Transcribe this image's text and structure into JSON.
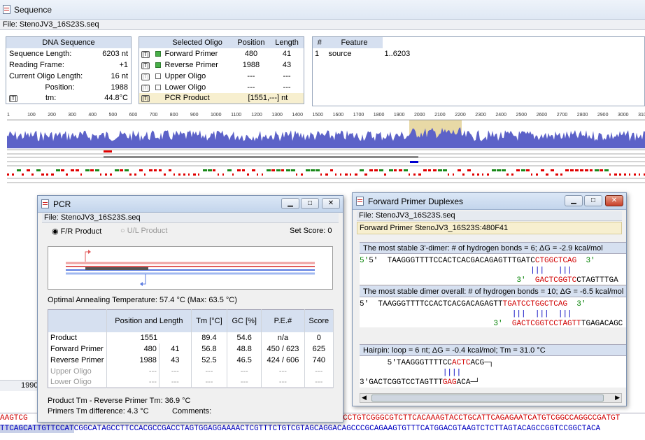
{
  "window": {
    "title": "Sequence",
    "file": "File: StenoJV3_16S23S.seq"
  },
  "dna": {
    "header": "DNA Sequence",
    "rows": [
      {
        "label": "Sequence Length:",
        "value": "6203 nt"
      },
      {
        "label": "Reading Frame:",
        "value": "+1"
      },
      {
        "label": "Current Oligo Length:",
        "value": "16 nt"
      },
      {
        "label": "Position:",
        "value": "1988"
      },
      {
        "label": "tm:",
        "value": "44.8°C"
      }
    ]
  },
  "oligo": {
    "headers": [
      "Selected Oligo",
      "Position",
      "Length"
    ],
    "rows": [
      {
        "name": "Forward Primer",
        "position": "480",
        "length": "41",
        "checked": true
      },
      {
        "name": "Reverse Primer",
        "position": "1988",
        "length": "43",
        "checked": true
      },
      {
        "name": "Upper Oligo",
        "position": "---",
        "length": "---",
        "checked": false
      },
      {
        "name": "Lower Oligo",
        "position": "---",
        "length": "---",
        "checked": false
      }
    ],
    "product": {
      "name": "PCR Product",
      "value": "[1551,---] nt"
    }
  },
  "feature": {
    "headers": [
      "#",
      "Feature",
      ""
    ],
    "rows": [
      {
        "n": "1",
        "name": "source",
        "range": "1..6203"
      }
    ]
  },
  "ruler": [
    "1",
    "100",
    "200",
    "300",
    "400",
    "500",
    "600",
    "700",
    "800",
    "900",
    "1000",
    "1100",
    "1200",
    "1300",
    "1400",
    "1500",
    "1600",
    "1700",
    "1800",
    "1900",
    "2000",
    "2100",
    "2200",
    "2300",
    "2400",
    "2500",
    "2600",
    "2700",
    "2800",
    "2900",
    "3000",
    "310"
  ],
  "pcr": {
    "title": "PCR",
    "file": "File: StenoJV3_16S23S.seq",
    "radio_fr": "F/R Product",
    "radio_ul": "U/L Product",
    "set_score": "Set Score: 0",
    "annealing": "Optimal Annealing Temperature: 57.4 °C (Max: 63.5 °C)",
    "headers": [
      "Position and Length",
      "Tm [°C]",
      "GC [%]",
      "P.E.#",
      "Score"
    ],
    "rows": [
      {
        "name": "Product",
        "pos": "1551",
        "len": "",
        "tm": "89.4",
        "gc": "54.6",
        "pe": "n/a",
        "score": "0"
      },
      {
        "name": "Forward Primer",
        "pos": "480",
        "len": "41",
        "tm": "56.8",
        "gc": "48.8",
        "pe": "450 / 623",
        "score": "625"
      },
      {
        "name": "Reverse Primer",
        "pos": "1988",
        "len": "43",
        "tm": "52.5",
        "gc": "46.5",
        "pe": "424 / 606",
        "score": "740"
      },
      {
        "name": "Upper Oligo",
        "pos": "---",
        "len": "---",
        "tm": "---",
        "gc": "---",
        "pe": "---",
        "score": "---"
      },
      {
        "name": "Lower Oligo",
        "pos": "---",
        "len": "---",
        "tm": "---",
        "gc": "---",
        "pe": "---",
        "score": "---"
      }
    ],
    "product_tm": "Product Tm - Reverse Primer Tm: 36.9 °C",
    "primer_tm": "Primers Tm difference: 4.3 °C",
    "comments": "Comments:"
  },
  "fpd": {
    "title": "Forward Primer Duplexes",
    "file": "File: StenoJV3_16S23S.seq",
    "subtitle": "Forward Primer StenoJV3_16S23S:480F41",
    "s1": {
      "head": "The most stable 3'-dimer: # of hydrogen bonds = 6; ΔG = -2.9 kcal/mol",
      "l1a": "5'  TAAGGGTTTTCCACTCACGACAGAGTTTGATC",
      "l1b": "CTGGCTCAG",
      "l1c": "  3'",
      "l2": "                                     |||   |||",
      "l3a": "                                  3'  ",
      "l3b": "GACTCGGTC",
      "l3c": "CTAGTTTGA"
    },
    "s2": {
      "head": "The most stable dimer overall: # of hydrogen bonds = 10; ΔG = -6.5 kcal/mol",
      "l1a": "5'  TAAGGGTTTTCCACTCACGACAGAGTT",
      "l1b": "TGATCCTGGCTCAG",
      "l1c": "  3'",
      "l2": "                                 |||  |||  |||",
      "l3a": "                             3'  ",
      "l3b": "GACTCGGTCCTAGTT",
      "l3c": "TGAGACAGC"
    },
    "s3": {
      "head": "Hairpin: loop = 6 nt; ΔG = -0.4 kcal/mol; Tm = 31.0 °C",
      "l1a": "    5'TAAGGGTTTTCC",
      "l1b": "ACTC",
      "l1c": "ACG",
      "l2": "                  ||||",
      "l3a": "3'GACTCGGTCCTAGTTT",
      "l3b": "GAG",
      "l3c": "ACA"
    }
  },
  "bottom": {
    "pos_label": "1990",
    "seq1_a": "AAGTCG",
    "seq1_b": "TCCTGTCGGGCGTCTTCACAAAGTACCTGCATTCAGAGAATCATGTCGGCCAGGCCGATGT",
    "seq2_a": "TTCAGCATTGTTCCAT",
    "seq2_b": "CGGCATAGCCTTCCACGCCGACCTAGTGGAGGAAAACTCGTTTCTGTCGTAGCAGGACAGCCCGCAGAAGTGTTTCATGGACGTAAGTCTCTTAGTACAGCCGGTCCGGCTACA"
  }
}
